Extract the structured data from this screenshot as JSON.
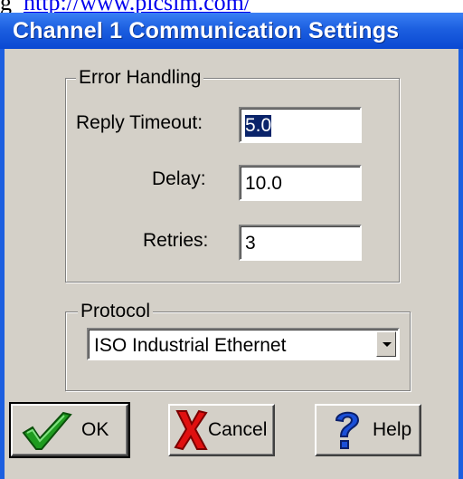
{
  "page": {
    "leading_glyph": "g",
    "link_text": "http://www.plcsim.com/"
  },
  "window": {
    "title": "Channel 1 Communication Settings"
  },
  "error_handling": {
    "title": "Error Handling",
    "reply_timeout": {
      "label": "Reply Timeout:",
      "value": "5.0"
    },
    "delay": {
      "label": "Delay:",
      "value": "10.0"
    },
    "retries": {
      "label": "Retries:",
      "value": "3"
    }
  },
  "protocol": {
    "title": "Protocol",
    "selected": "ISO Industrial Ethernet"
  },
  "buttons": {
    "ok": "OK",
    "cancel": "Cancel",
    "help": "Help"
  },
  "icons": {
    "ok": "green-checkmark-icon",
    "cancel": "red-x-icon",
    "help": "blue-question-mark-icon"
  },
  "colors": {
    "titlebar": "#1c5fe0",
    "dialog_face": "#d4d0c8",
    "selection": "#0a246a",
    "link": "#0000ee"
  }
}
